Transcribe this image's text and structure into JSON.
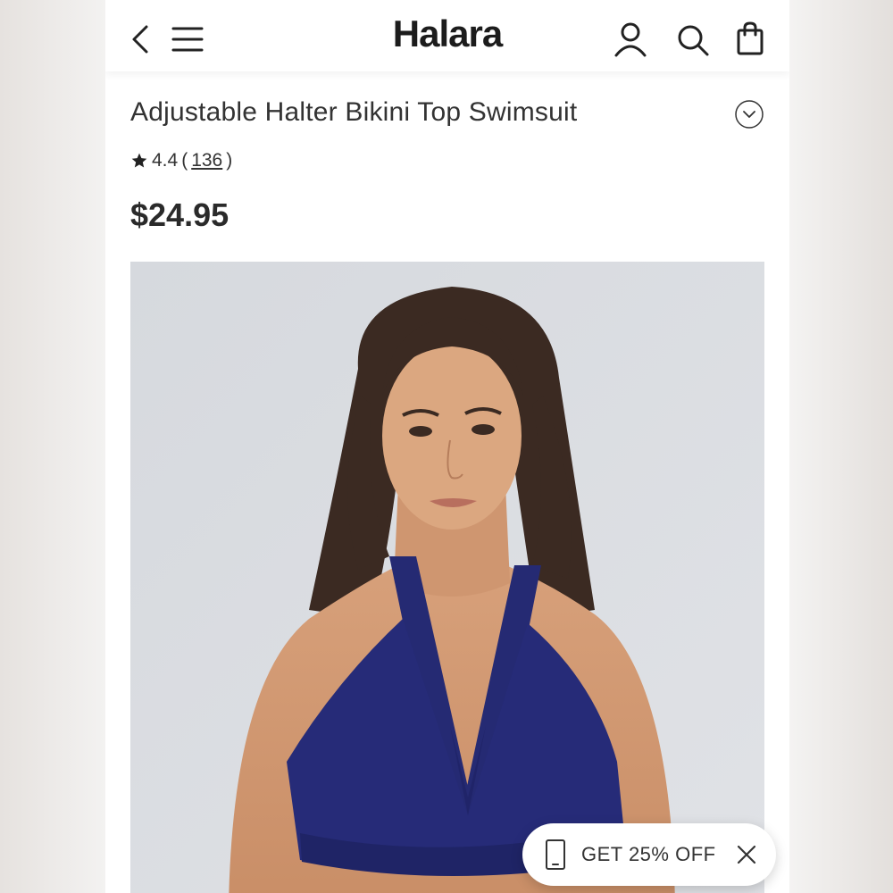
{
  "header": {
    "back_icon": "chevron-left-icon",
    "menu_icon": "hamburger-menu-icon",
    "brand": "Halara",
    "account_icon": "user-icon",
    "search_icon": "search-icon",
    "bag_icon": "shopping-bag-icon"
  },
  "product": {
    "title": "Adjustable Halter Bikini Top Swimsuit",
    "rating": "4.4",
    "paren_open": "(",
    "review_count": "136",
    "paren_close": ")",
    "price": "$24.95"
  },
  "promo": {
    "text": "GET 25% OFF",
    "icon": "phone-icon",
    "close_icon": "close-icon"
  },
  "colors": {
    "accent": "#1c1c1c",
    "swimsuit_navy": "#252a73",
    "photo_background": "#d9dce0"
  }
}
